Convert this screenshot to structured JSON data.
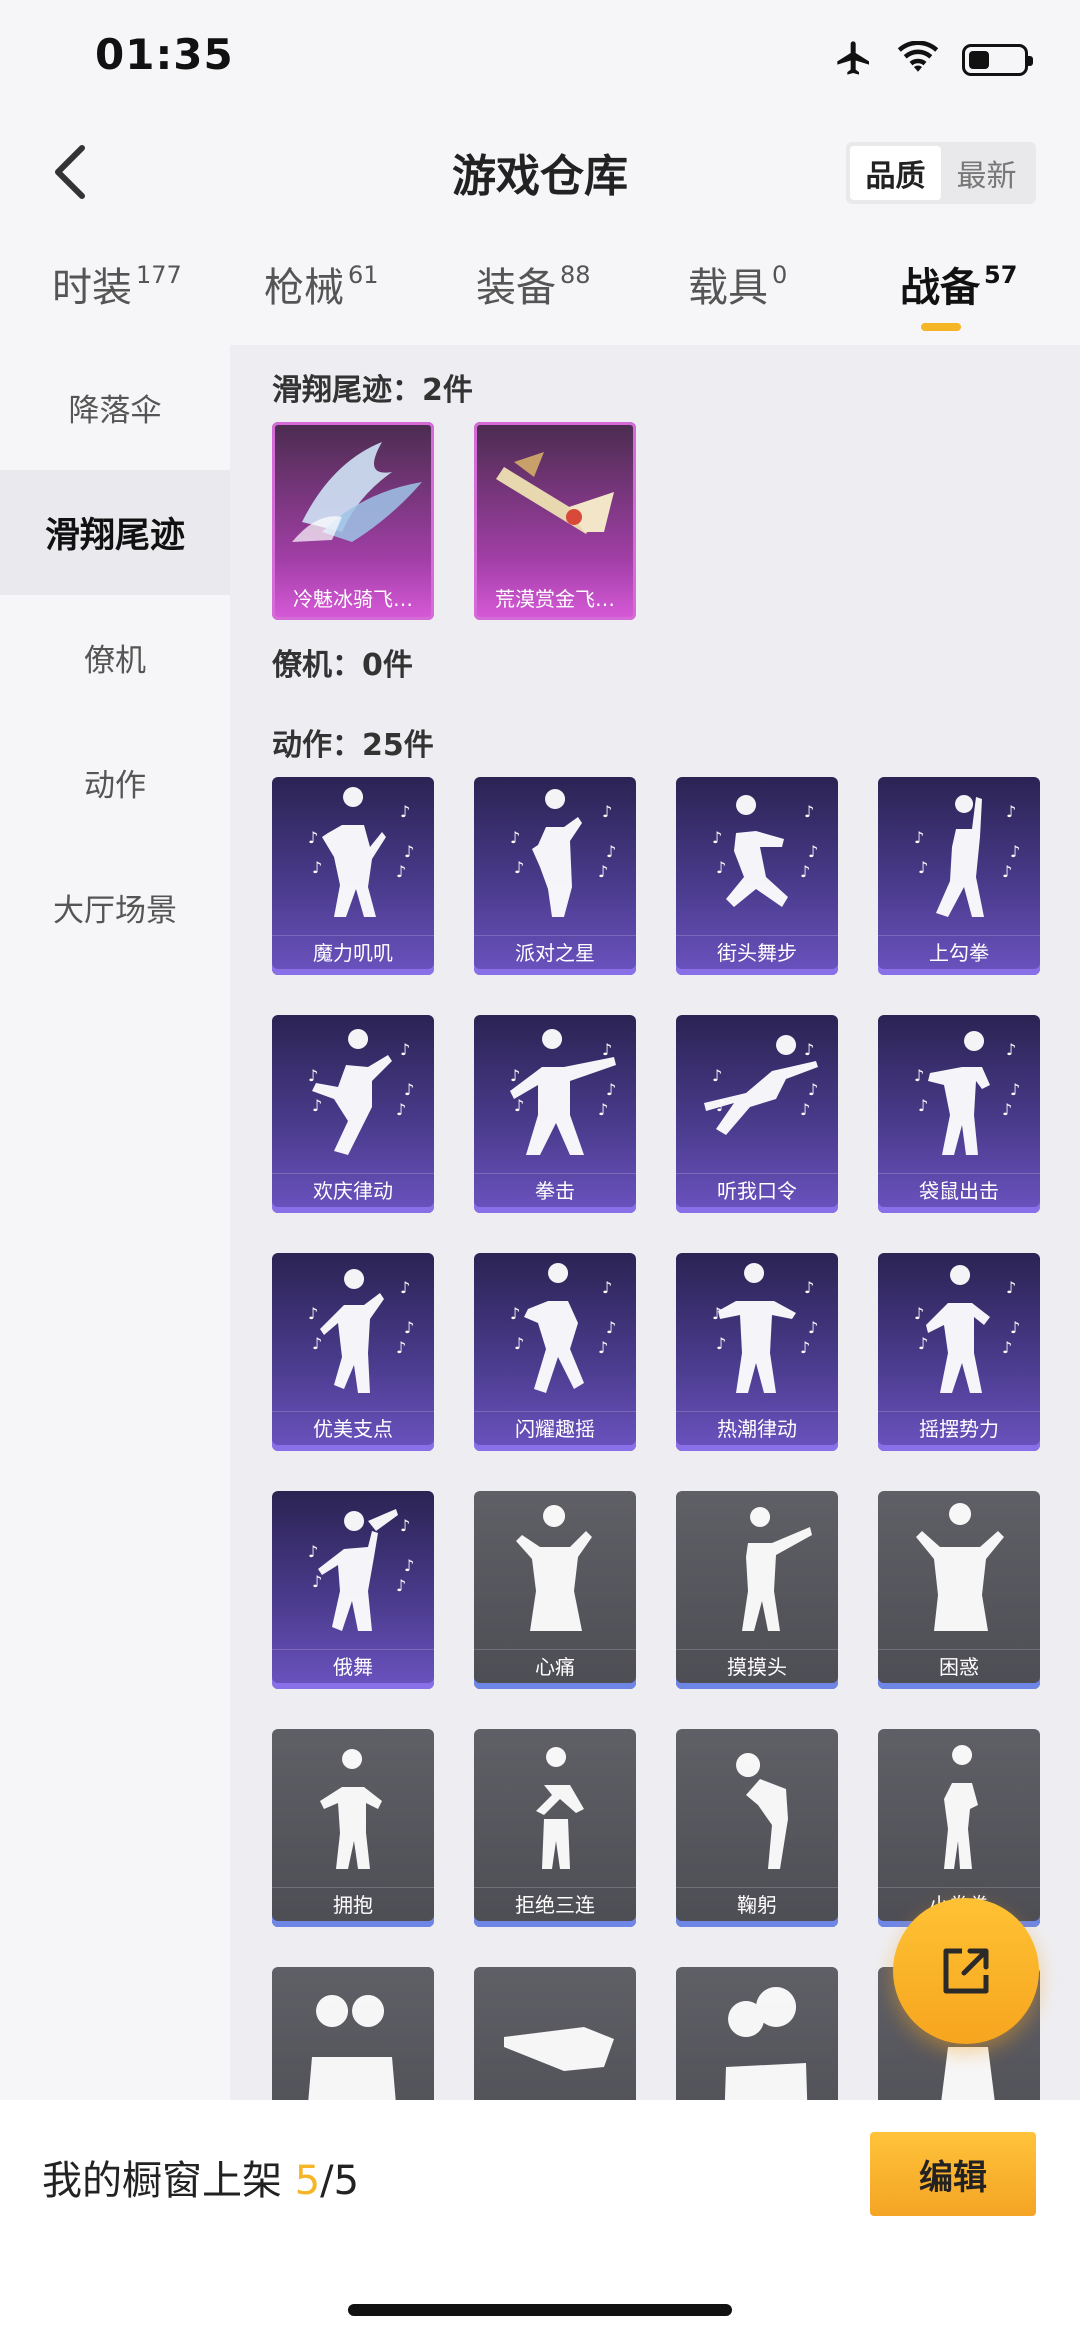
{
  "status": {
    "time": "01:35"
  },
  "header": {
    "title": "游戏仓库",
    "sort_options": [
      {
        "label": "品质",
        "active": true
      },
      {
        "label": "最新",
        "active": false
      }
    ]
  },
  "tabs": [
    {
      "label": "时装",
      "count": "177",
      "active": false
    },
    {
      "label": "枪械",
      "count": "61",
      "active": false
    },
    {
      "label": "装备",
      "count": "88",
      "active": false
    },
    {
      "label": "载具",
      "count": "0",
      "active": false
    },
    {
      "label": "战备",
      "count": "57",
      "active": true
    }
  ],
  "sidebar": {
    "items": [
      {
        "label": "降落伞",
        "active": false
      },
      {
        "label": "滑翔尾迹",
        "active": true
      },
      {
        "label": "僚机",
        "active": false
      },
      {
        "label": "动作",
        "active": false
      },
      {
        "label": "大厅场景",
        "active": false
      }
    ]
  },
  "sections": {
    "glide": {
      "title": "滑翔尾迹：2件",
      "items": [
        "冷魅冰骑飞…",
        "荒漠赏金飞…"
      ]
    },
    "wingman": {
      "title": "僚机：0件"
    },
    "emotes": {
      "title": "动作：25件",
      "items": [
        "魔力叽叽",
        "派对之星",
        "街头舞步",
        "上勾拳",
        "欢庆律动",
        "拳击",
        "听我口令",
        "袋鼠出击",
        "优美支点",
        "闪耀趣摇",
        "热潮律动",
        "摇摆势力",
        "俄舞",
        "心痛",
        "摸摸头",
        "困惑",
        "拥抱",
        "拒绝三连",
        "鞠躬",
        "小拳拳",
        "",
        "",
        "",
        ""
      ]
    }
  },
  "bottom": {
    "showcase_label": "我的橱窗上架",
    "showcase_current": "5",
    "showcase_total": "/5",
    "edit_label": "编辑"
  },
  "colors": {
    "accent": "#f5b526",
    "purple_card": "#4a3b8c",
    "gray_card": "#55555c",
    "magenta_card": "#a23fa7"
  }
}
